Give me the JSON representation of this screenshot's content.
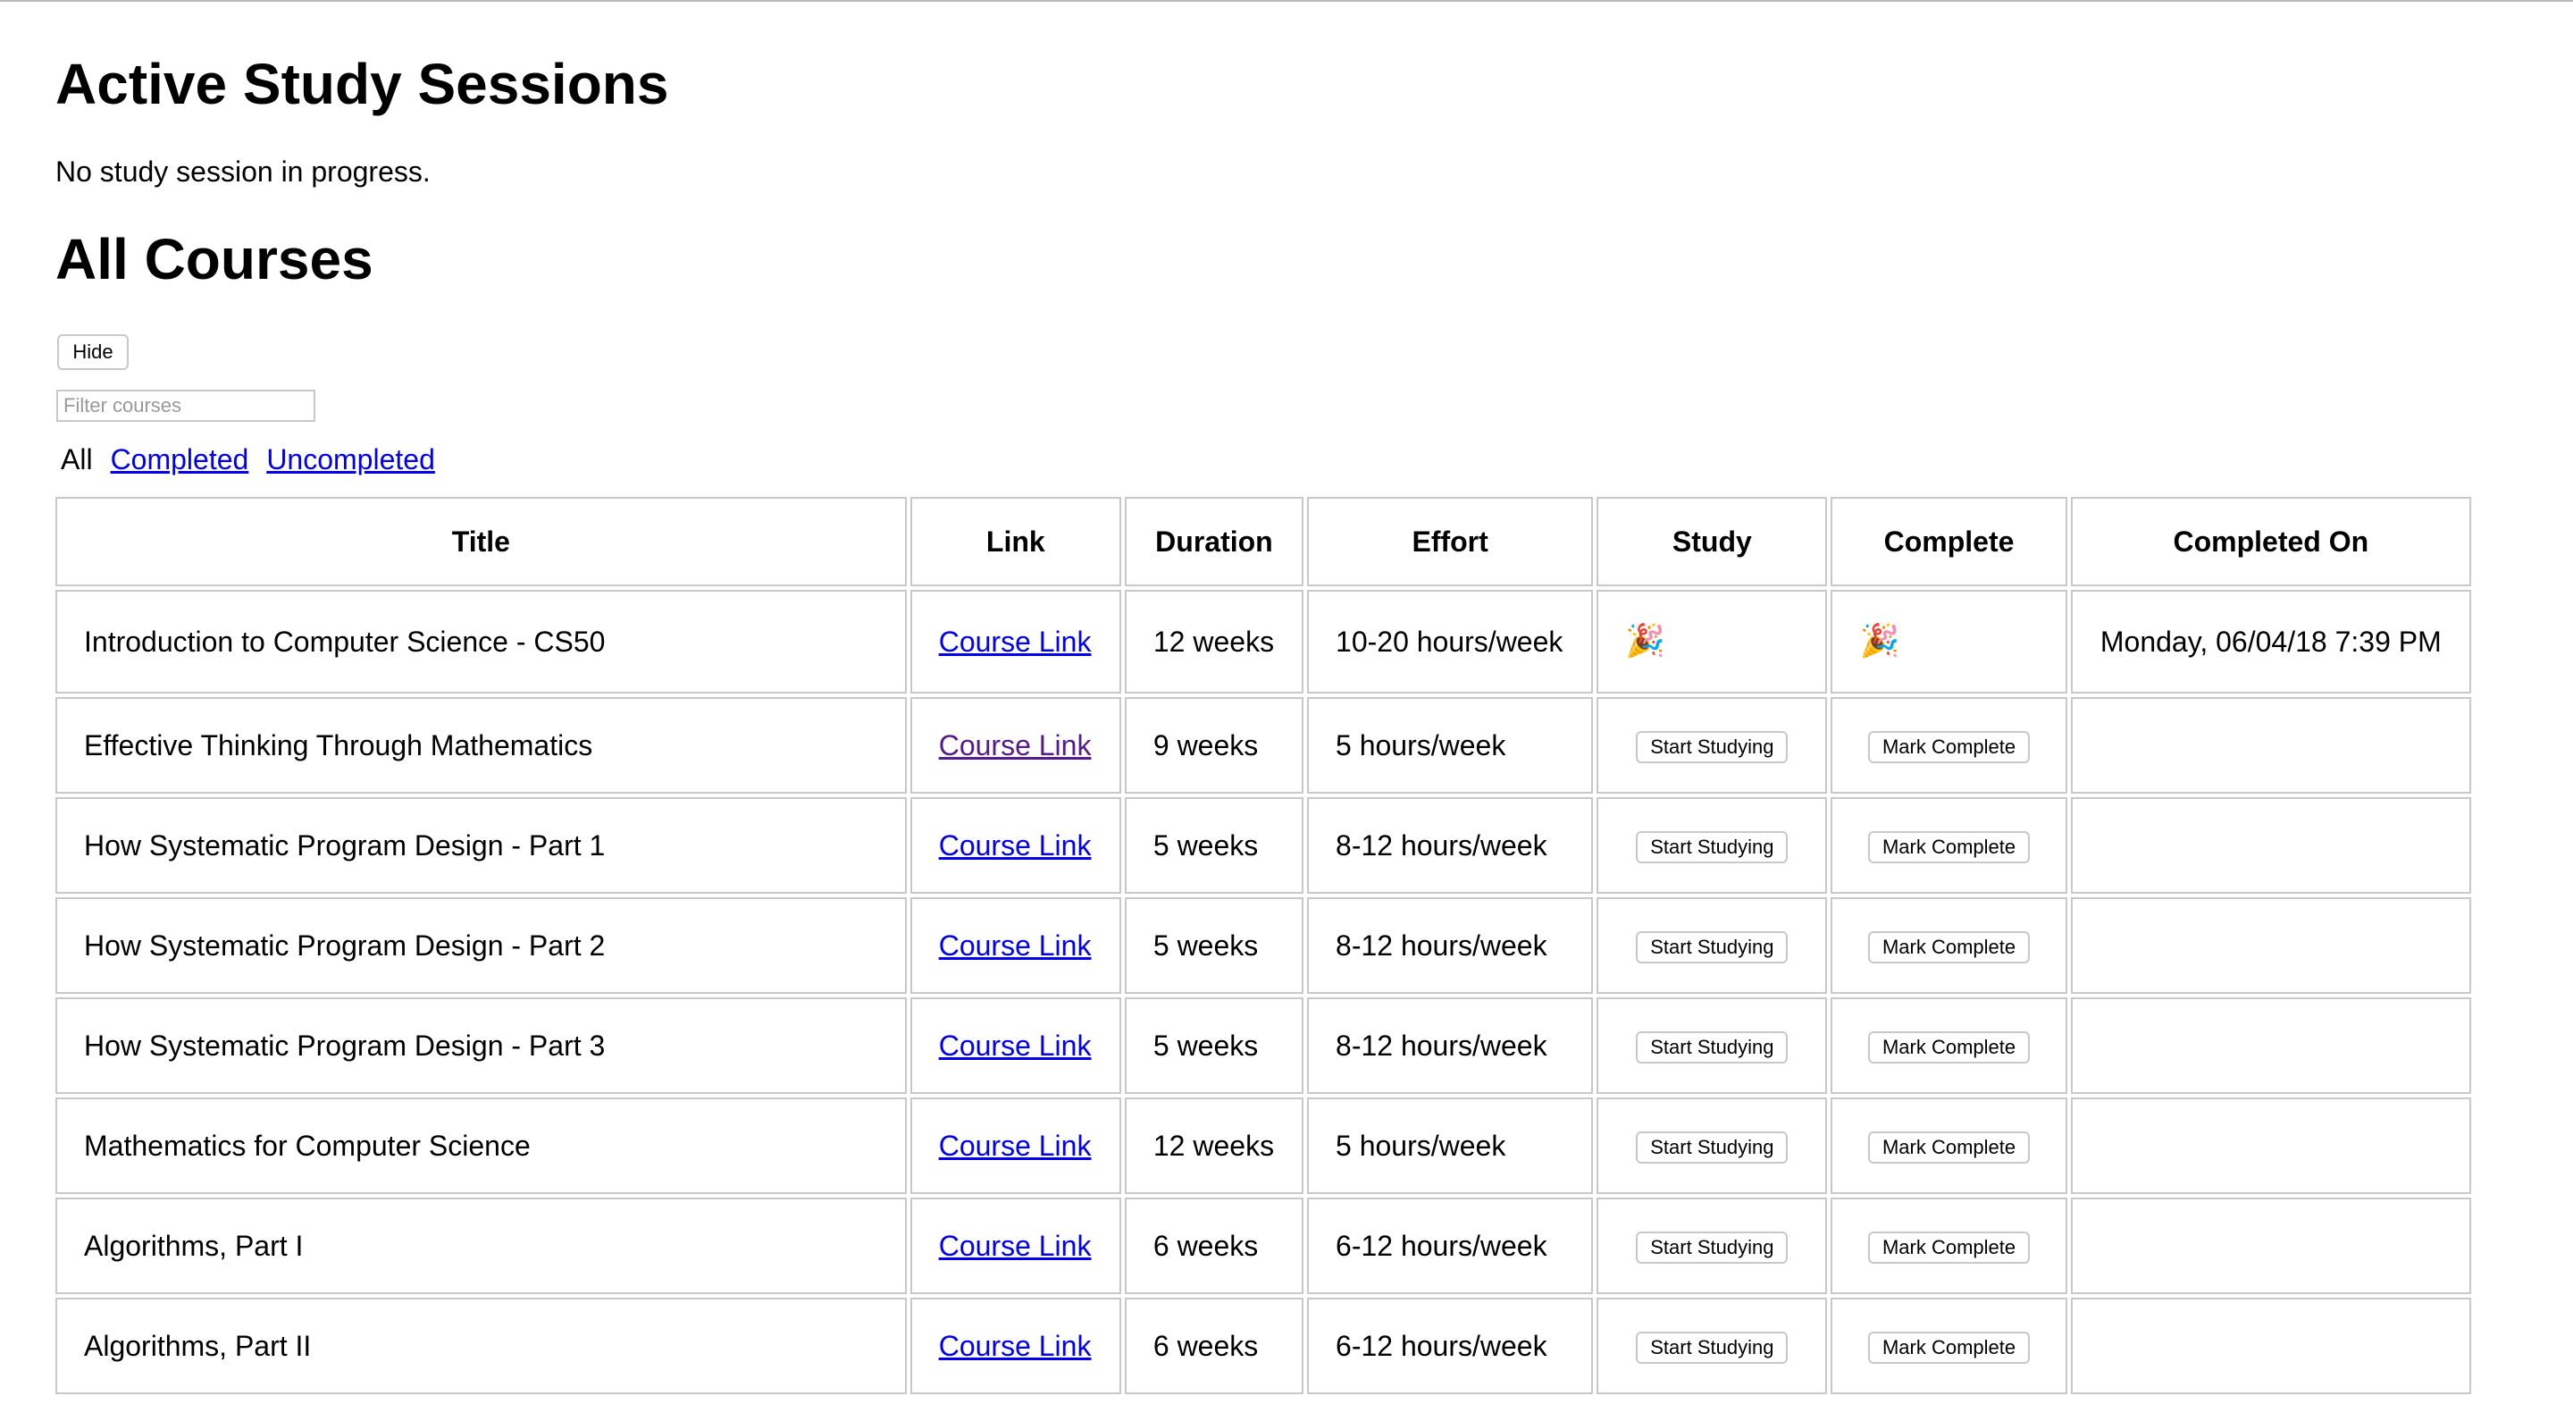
{
  "active": {
    "title": "Active Study Sessions",
    "status": "No study session in progress."
  },
  "courses": {
    "title": "All Courses",
    "hide_label": "Hide",
    "filter_placeholder": "Filter courses",
    "filters": {
      "all": "All",
      "completed": "Completed",
      "uncompleted": "Uncompleted"
    },
    "columns": [
      "Title",
      "Link",
      "Duration",
      "Effort",
      "Study",
      "Complete",
      "Completed On"
    ],
    "rows": [
      {
        "title": "Introduction to Computer Science - CS50",
        "link": "Course Link",
        "duration": "12 weeks",
        "effort": "10-20 hours/week",
        "study": "🎉",
        "complete": "🎉",
        "completed_on": "Monday, 06/04/18 7:39 PM"
      },
      {
        "title": "Effective Thinking Through Mathematics",
        "link": "Course Link",
        "duration": "9 weeks",
        "effort": "5 hours/week",
        "study": "Start Studying",
        "complete": "Mark Complete",
        "completed_on": ""
      },
      {
        "title": "How Systematic Program Design - Part 1",
        "link": "Course Link",
        "duration": "5 weeks",
        "effort": "8-12 hours/week",
        "study": "Start Studying",
        "complete": "Mark Complete",
        "completed_on": ""
      },
      {
        "title": "How Systematic Program Design - Part 2",
        "link": "Course Link",
        "duration": "5 weeks",
        "effort": "8-12 hours/week",
        "study": "Start Studying",
        "complete": "Mark Complete",
        "completed_on": ""
      },
      {
        "title": "How Systematic Program Design - Part 3",
        "link": "Course Link",
        "duration": "5 weeks",
        "effort": "8-12 hours/week",
        "study": "Start Studying",
        "complete": "Mark Complete",
        "completed_on": ""
      },
      {
        "title": "Mathematics for Computer Science",
        "link": "Course Link",
        "duration": "12 weeks",
        "effort": "5 hours/week",
        "study": "Start Studying",
        "complete": "Mark Complete",
        "completed_on": ""
      },
      {
        "title": "Algorithms, Part I",
        "link": "Course Link",
        "duration": "6 weeks",
        "effort": "6-12 hours/week",
        "study": "Start Studying",
        "complete": "Mark Complete",
        "completed_on": ""
      },
      {
        "title": "Algorithms, Part II",
        "link": "Course Link",
        "duration": "6 weeks",
        "effort": "6-12 hours/week",
        "study": "Start Studying",
        "complete": "Mark Complete",
        "completed_on": ""
      }
    ],
    "colors": {
      "link": "#0000ee",
      "visited_link": "#551a8b",
      "border": "#c8c8c8"
    }
  }
}
